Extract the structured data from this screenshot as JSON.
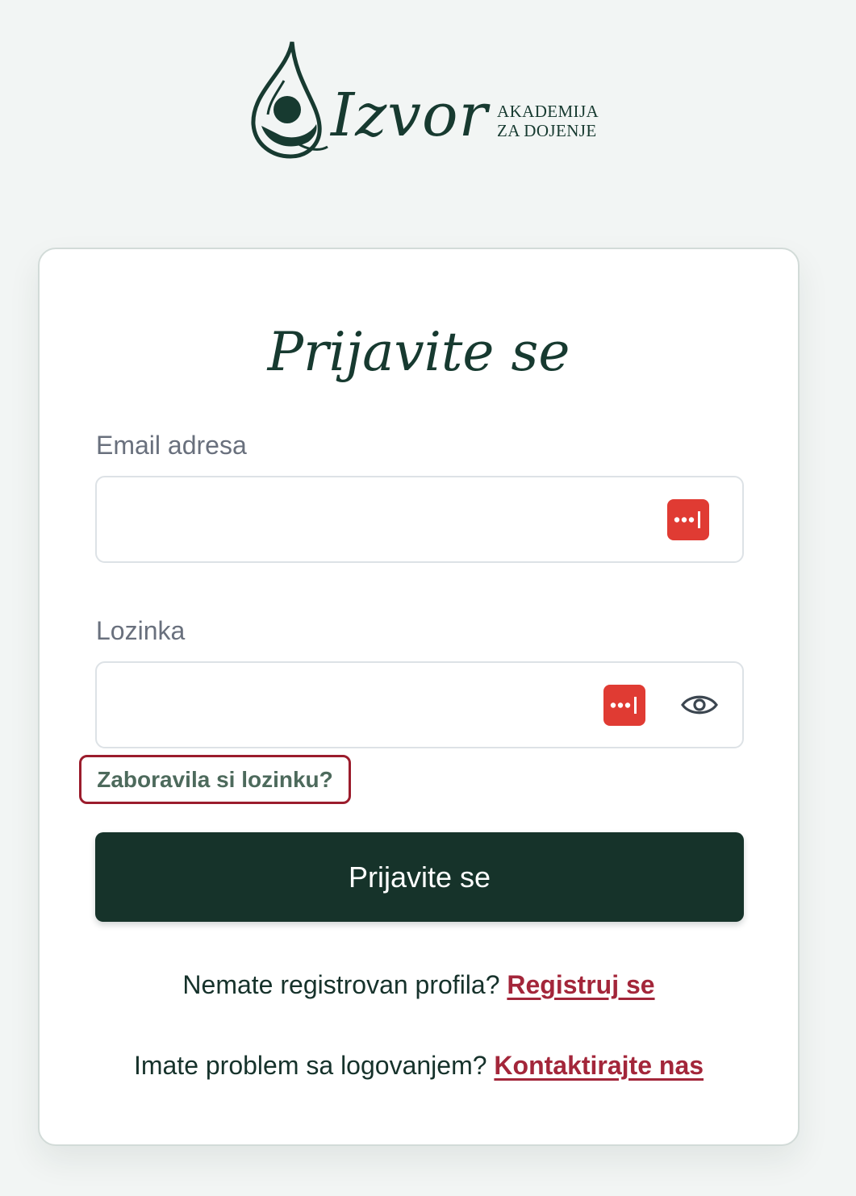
{
  "brand": {
    "wordmark": "Izvor",
    "tagline_line1": "AKADEMIJA",
    "tagline_line2": "ZA DOJENJE",
    "color": "#173a30"
  },
  "login": {
    "title": "Prijavite se",
    "email": {
      "label": "Email adresa",
      "value": "",
      "placeholder": "",
      "password_manager_icon": "password-manager-icon"
    },
    "password": {
      "label": "Lozinka",
      "value": "",
      "placeholder": "",
      "password_manager_icon": "password-manager-icon",
      "visibility_icon": "eye-icon"
    },
    "forgot_link": "Zaboravila si lozinku?",
    "submit_label": "Prijavite se",
    "register_prompt": "Nemate registrovan profila?",
    "register_link": "Registruj se",
    "contact_prompt": "Imate problem sa logovanjem?",
    "contact_link": "Kontaktirajte nas"
  },
  "colors": {
    "primary": "#16332a",
    "link": "#a3263a",
    "password_manager": "#e03b33",
    "focus_outline": "#9b1c2c",
    "background": "#f2f5f4"
  }
}
